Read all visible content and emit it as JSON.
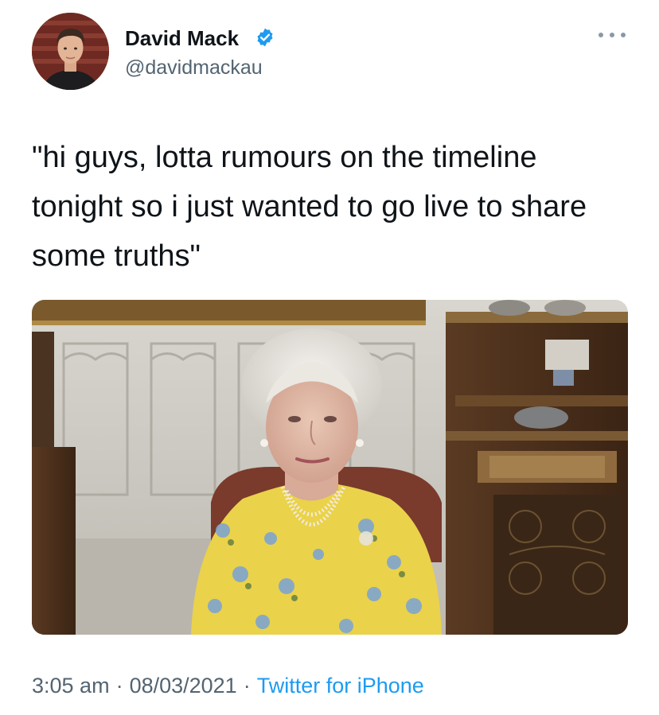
{
  "author": {
    "display_name": "David Mack",
    "handle": "@davidmackau",
    "verified": true,
    "avatar_icon": "profile-photo"
  },
  "tweet": {
    "text_lines": [
      "\"hi guys, lotta rumours on the timeline",
      "tonight so i just wanted to go live to share",
      "some truths\""
    ]
  },
  "media": {
    "type": "photo",
    "icon": "video-call-photo"
  },
  "footer": {
    "time": "3:05 am",
    "date": "08/03/2021",
    "separator": "·",
    "source": "Twitter for iPhone"
  },
  "colors": {
    "text_primary": "#0f1419",
    "text_secondary": "#536471",
    "link_blue": "#1d9bf0",
    "verified_blue": "#1d9bf0"
  }
}
